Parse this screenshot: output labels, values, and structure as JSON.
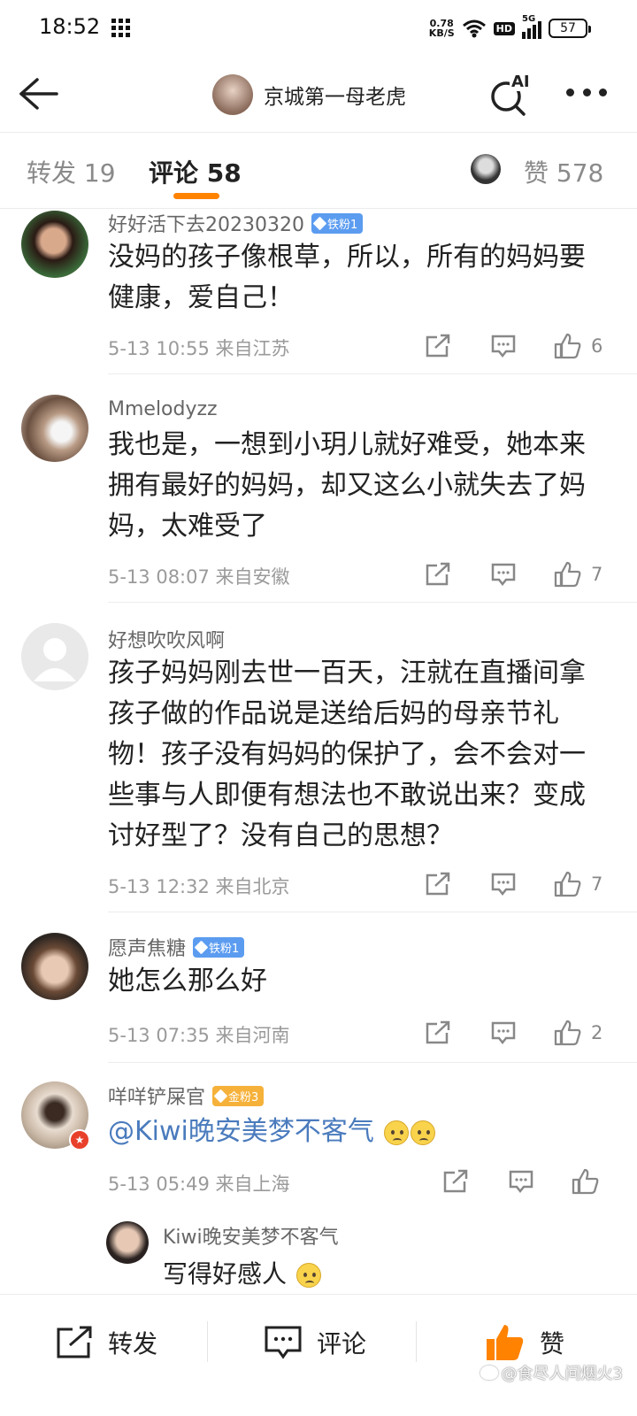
{
  "status_bar": {
    "time": "18:52",
    "net_speed_value": "0.78",
    "net_speed_unit": "KB/S",
    "hd": "HD",
    "signal": "5G",
    "battery": "57"
  },
  "header": {
    "title": "京城第一母老虎",
    "ai_label": "AI"
  },
  "tabs": {
    "repost": "转发 19",
    "comment": "评论 58",
    "like": "赞 578"
  },
  "comments": [
    {
      "user": "好好活下去20230320",
      "badge": "铁粉1",
      "text": "没妈的孩子像根草，所以，所有的妈妈要健康，爱自己！",
      "meta": "5-13 10:55  来自江苏",
      "likes": "6"
    },
    {
      "user": "Mmelodyzz",
      "badge": "",
      "text": "我也是，一想到小玥儿就好难受，她本来拥有最好的妈妈，却又这么小就失去了妈妈，太难受了",
      "meta": "5-13 08:07  来自安徽",
      "likes": "7"
    },
    {
      "user": "好想吹吹风啊",
      "badge": "",
      "text": "孩子妈妈刚去世一百天，汪就在直播间拿孩子做的作品说是送给后妈的母亲节礼物！孩子没有妈妈的保护了，会不会对一些事与人即便有想法也不敢说出来？变成讨好型了？没有自己的思想？",
      "meta": "5-13 12:32  来自北京",
      "likes": "7"
    },
    {
      "user": "愿声焦糖",
      "badge": "铁粉1",
      "text": "她怎么那么好",
      "meta": "5-13 07:35  来自河南",
      "likes": "2"
    },
    {
      "user": "咩咩铲屎官",
      "badge": "金粉3",
      "text": "@Kiwi晚安美梦不客气",
      "meta": "5-13 05:49  来自上海",
      "likes": ""
    }
  ],
  "reply": {
    "user": "Kiwi晚安美梦不客气",
    "text": "写得好感人"
  },
  "bottom_bar": {
    "repost": "转发",
    "comment": "评论",
    "like": "赞"
  },
  "watermark": "@食尽人间烟火3",
  "colors": {
    "accent": "#ff8200",
    "mention": "#4a7bbd",
    "badge_iron": "#5b9cf0",
    "badge_gold": "#f6b13a"
  }
}
